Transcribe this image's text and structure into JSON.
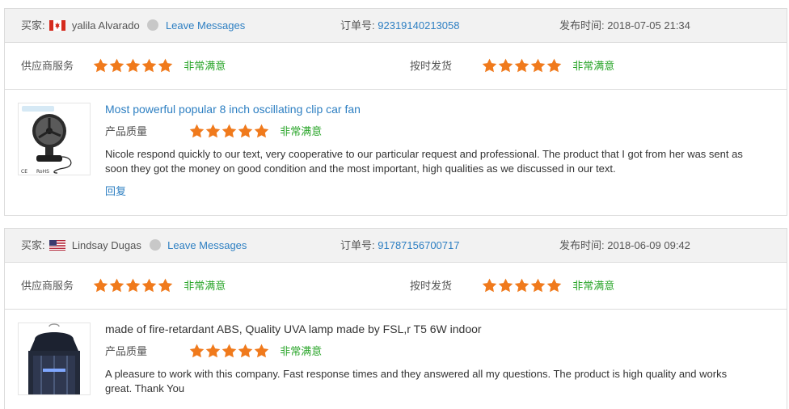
{
  "labels": {
    "buyer": "买家:",
    "order": "订单号:",
    "time": "发布时间:",
    "supplier_service": "供应商服务",
    "on_time_shipping": "按时发货",
    "product_quality": "产品质量",
    "satisfaction": "非常满意",
    "reply": "回复",
    "leave_messages": "Leave Messages"
  },
  "colors": {
    "star": "#f07a1c",
    "link": "#2d7fc2",
    "satisfaction": "#2aa52a",
    "header_bg": "#f2f2f2"
  },
  "reviews": [
    {
      "buyer_name": "yalila Alvarado",
      "country_flag": "canada-flag",
      "order_no": "92319140213058",
      "published": "2018-07-05 21:34",
      "supplier_stars": 5,
      "shipping_stars": 5,
      "quality_stars": 5,
      "product_title": "Most powerful popular 8 inch oscillating clip car fan",
      "review_text": "Nicole respond quickly to our text, very cooperative to our particular request and professional. The product that I got from her was sent as soon they got the money on good condition and the most important, high qualities as we discussed in our text.",
      "thumbnail_badges": [
        "CE",
        "RoHS"
      ]
    },
    {
      "buyer_name": "Lindsay Dugas",
      "country_flag": "usa-flag",
      "order_no": "91787156700717",
      "published": "2018-06-09 09:42",
      "supplier_stars": 5,
      "shipping_stars": 5,
      "quality_stars": 5,
      "product_title": "made of fire-retardant ABS, Quality UVA lamp made by FSL,r T5 6W indoor",
      "review_text": "A pleasure to work with this company. Fast response times and they answered all my questions. The product is high quality and works great. Thank You"
    }
  ]
}
